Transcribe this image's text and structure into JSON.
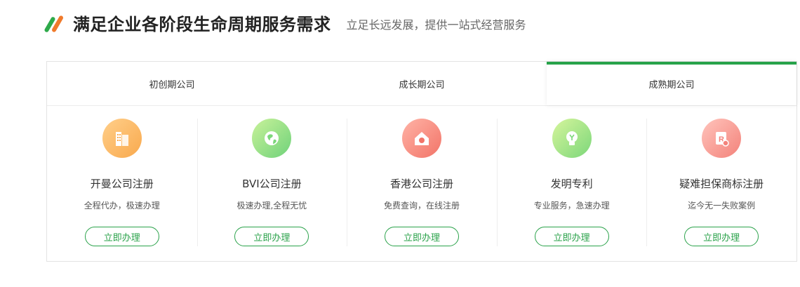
{
  "header": {
    "title": "满足企业各阶段生命周期服务需求",
    "subtitle": "立足长远发展，提供一站式经营服务"
  },
  "tabs": [
    {
      "label": "初创期公司",
      "active": false
    },
    {
      "label": "成长期公司",
      "active": false
    },
    {
      "label": "成熟期公司",
      "active": true
    }
  ],
  "cards": [
    {
      "icon": "building-icon",
      "title": "开曼公司注册",
      "desc": "全程代办，极速办理",
      "button": "立即办理"
    },
    {
      "icon": "globe-icon",
      "title": "BVI公司注册",
      "desc": "极速办理,全程无忧",
      "button": "立即办理"
    },
    {
      "icon": "hk-house-icon",
      "title": "香港公司注册",
      "desc": "免费查询，在线注册",
      "button": "立即办理"
    },
    {
      "icon": "lightbulb-icon",
      "title": "发明专利",
      "desc": "专业服务，急速办理",
      "button": "立即办理"
    },
    {
      "icon": "trademark-icon",
      "title": "疑难担保商标注册",
      "desc": "迄今无一失败案例",
      "button": "立即办理"
    }
  ],
  "colors": {
    "accent": "#27a34a",
    "logo_orange": "#f07a2b"
  }
}
